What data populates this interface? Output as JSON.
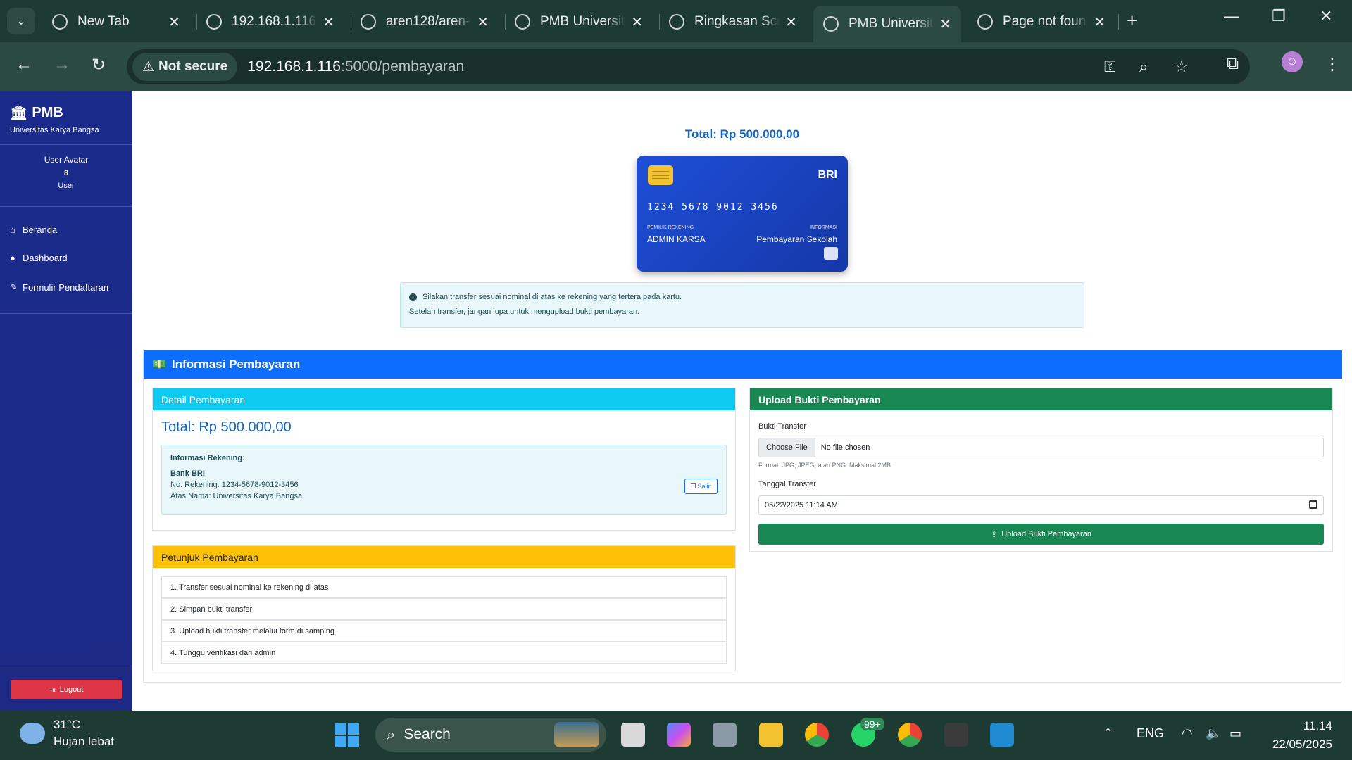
{
  "browser": {
    "tabs": [
      {
        "title": "New Tab",
        "icon": "chrome-icon"
      },
      {
        "title": "192.168.1.116:",
        "icon": "globe-loading-icon"
      },
      {
        "title": "aren128/aren-",
        "icon": "github-icon"
      },
      {
        "title": "PMB Universit",
        "icon": "globe-icon"
      },
      {
        "title": "Ringkasan Scr",
        "icon": "openai-icon"
      },
      {
        "title": "PMB Universit",
        "icon": "globe-icon",
        "active": true
      },
      {
        "title": "Page not foun",
        "icon": "github-icon"
      }
    ],
    "security_label": "Not secure",
    "url_host": "192.168.1.116",
    "url_path": ":5000/pembayaran"
  },
  "sidebar": {
    "brand_title": "PMB",
    "brand_subtitle": "Universitas Karya Bangsa",
    "avatar_alt": "User Avatar",
    "user_id": "8",
    "user_role": "User",
    "items": [
      {
        "label": "Beranda",
        "icon": "home-icon"
      },
      {
        "label": "Dashboard",
        "icon": "user-icon"
      },
      {
        "label": "Formulir Pendaftaran",
        "icon": "edit-icon"
      }
    ],
    "logout_label": "Logout"
  },
  "payment_card": {
    "total_label": "Total: Rp 500.000,00",
    "bank": "BRI",
    "number": "1234 5678 9012 3456",
    "holder_label": "PEMILIK REKENING",
    "holder_value": "ADMIN KARSA",
    "info_label": "INFORMASI",
    "info_value": "Pembayaran Sekolah"
  },
  "alert": {
    "line1": "Silakan transfer sesuai nominal di atas ke rekening yang tertera pada kartu.",
    "line2": "Setelah transfer, jangan lupa untuk mengupload bukti pembayaran."
  },
  "info_panel": {
    "title": "Informasi Pembayaran",
    "detail": {
      "header": "Detail Pembayaran",
      "total": "Total: Rp 500.000,00",
      "rek_title": "Informasi Rekening:",
      "bank": "Bank BRI",
      "number": "No. Rekening: 1234-5678-9012-3456",
      "name": "Atas Nama: Universitas Karya Bangsa",
      "copy_label": "Salin"
    },
    "instructions": {
      "header": "Petunjuk Pembayaran",
      "items": [
        "1. Transfer sesuai nominal ke rekening di atas",
        "2. Simpan bukti transfer",
        "3. Upload bukti transfer melalui form di samping",
        "4. Tunggu verifikasi dari admin"
      ]
    },
    "upload": {
      "header": "Upload Bukti Pembayaran",
      "file_label": "Bukti Transfer",
      "file_button": "Choose File",
      "file_status": "No file chosen",
      "file_help": "Format: JPG, JPEG, atau PNG. Maksimal 2MB",
      "date_label": "Tanggal Transfer",
      "date_value": "05/22/2025 11:14 AM",
      "submit_label": "Upload Bukti Pembayaran"
    }
  },
  "taskbar": {
    "temperature": "31°C",
    "weather": "Hujan lebat",
    "search_label": "Search",
    "whatsapp_badge": "99+",
    "language": "ENG",
    "time": "11.14",
    "date": "22/05/2025"
  },
  "colors": {
    "sidebar": "#1c2a86",
    "primary": "#0d6efd",
    "info": "#0dcaf0",
    "warning": "#ffc107",
    "success": "#198754",
    "danger": "#dc3545"
  }
}
